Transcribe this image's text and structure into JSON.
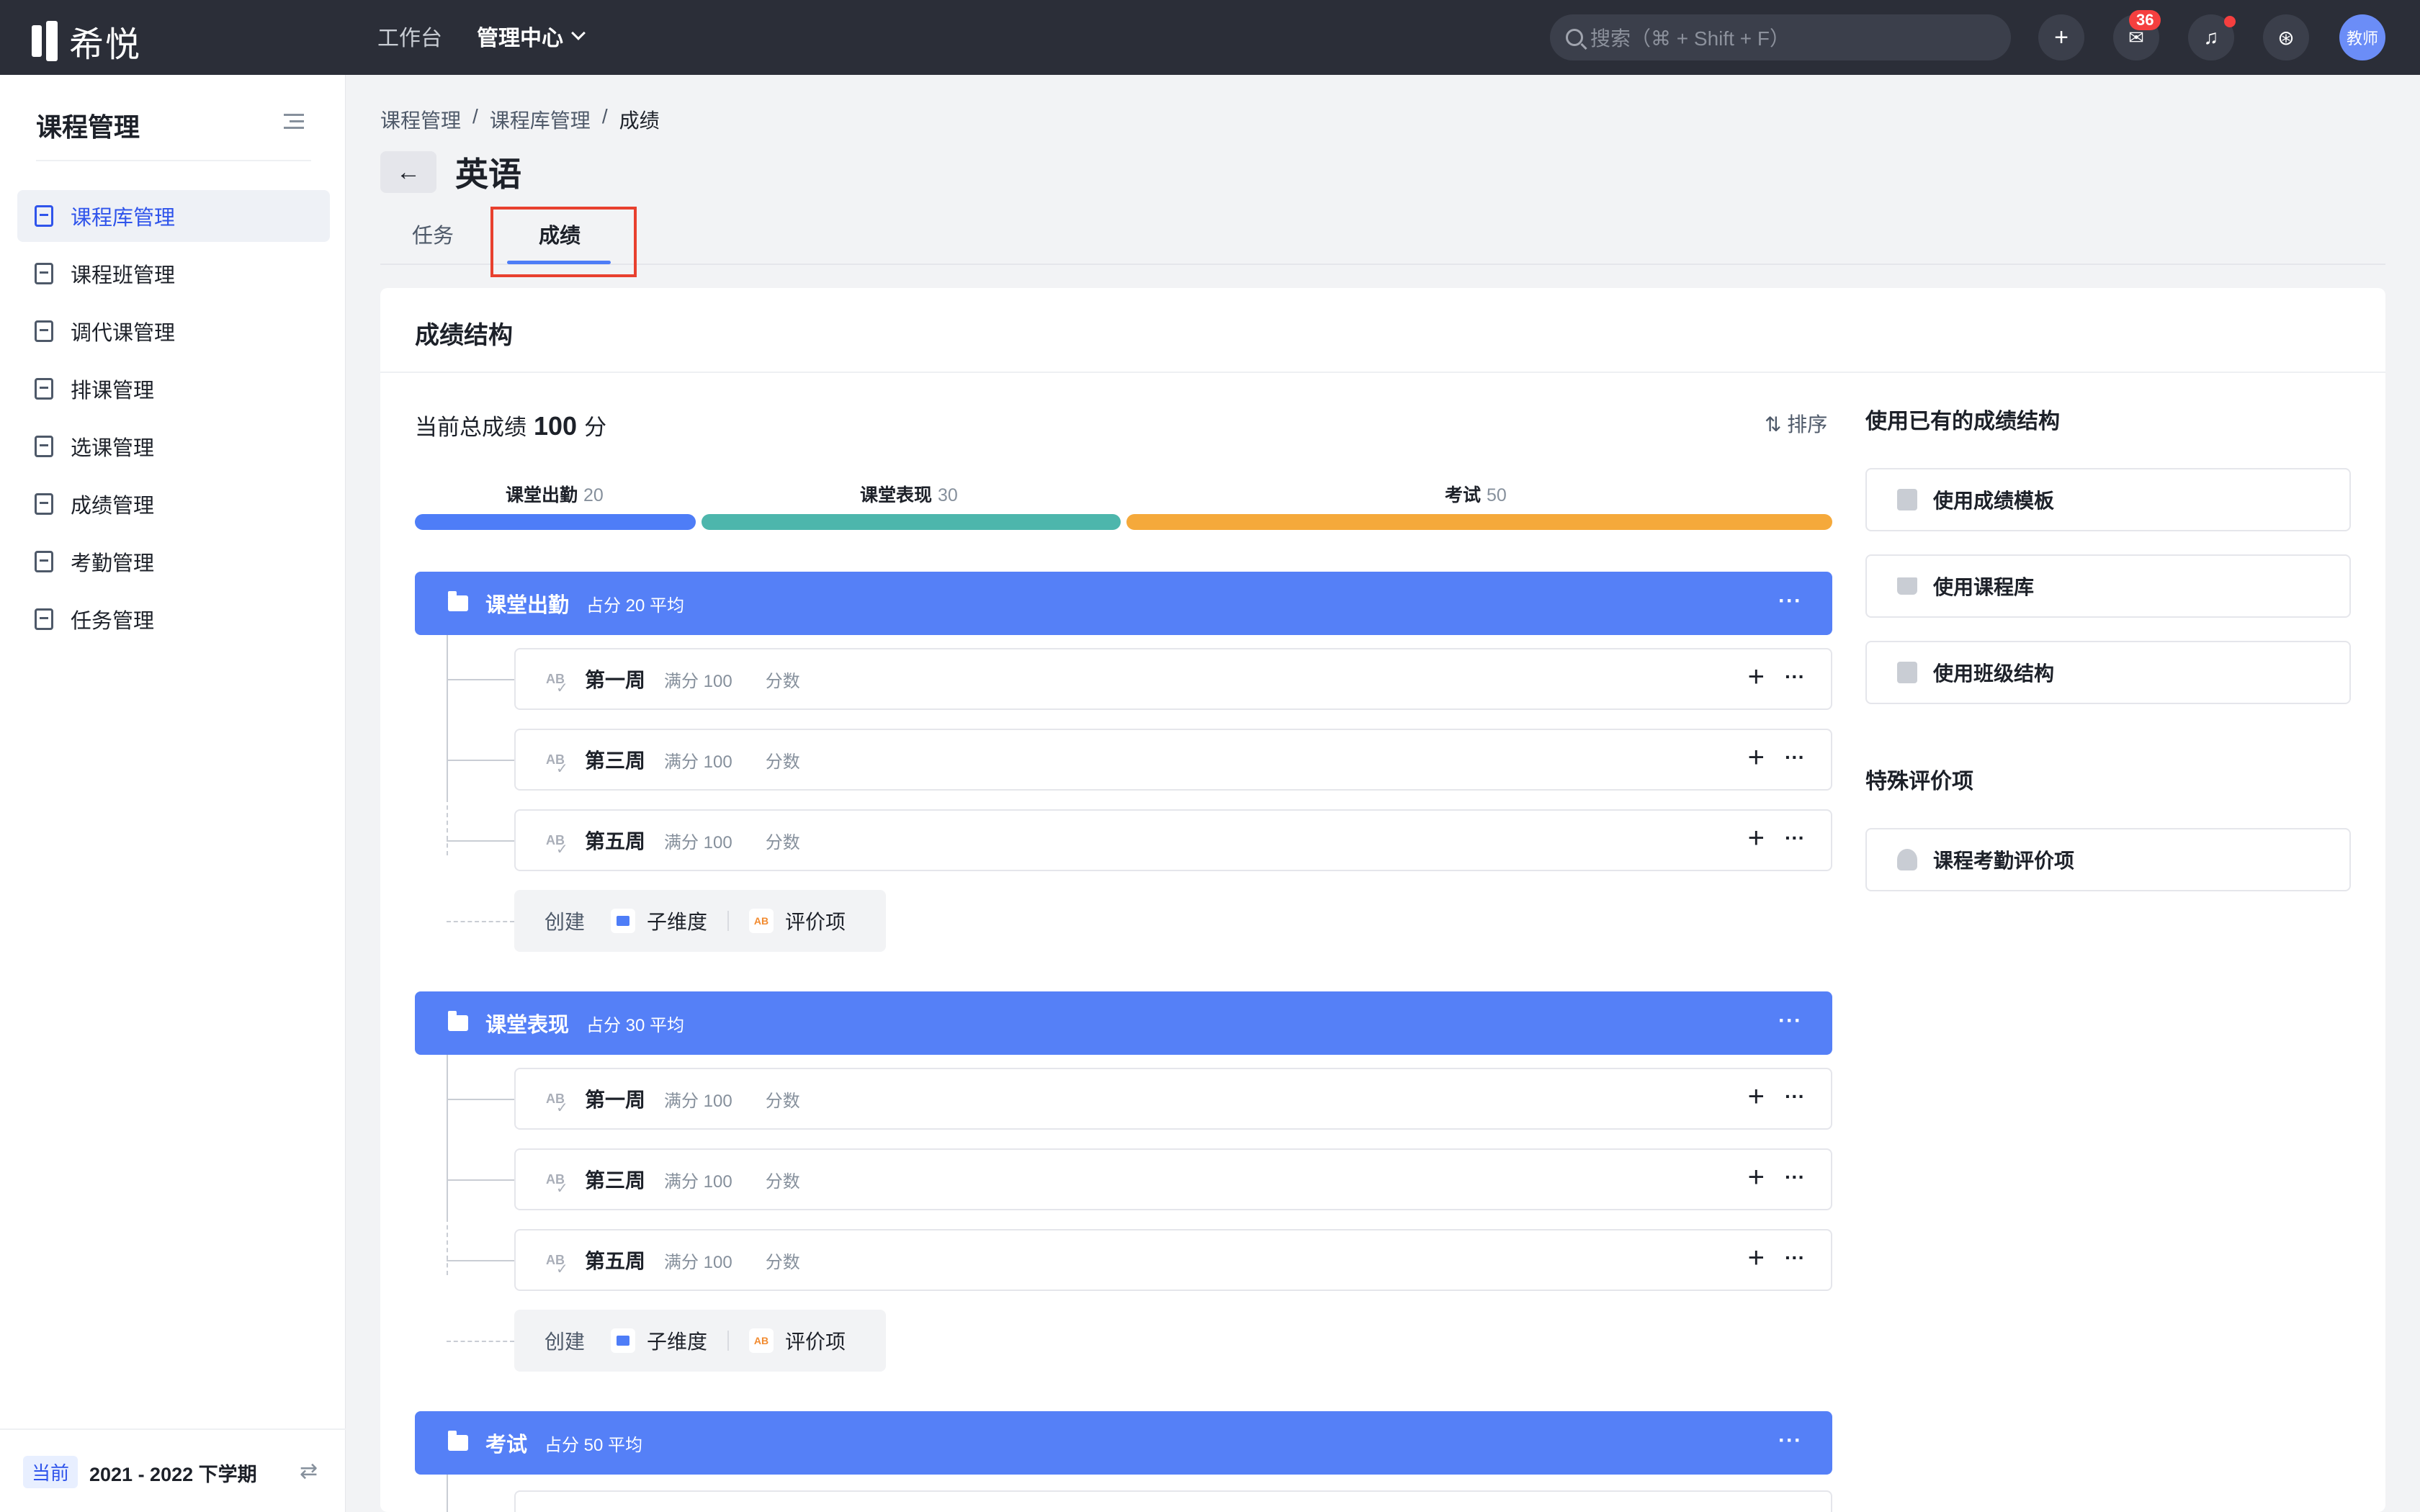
{
  "app": {
    "logo_text": "希悦",
    "nav": [
      "工作台",
      "管理中心"
    ],
    "search_placeholder": "搜索（⌘ + Shift + F）",
    "message_count": "36",
    "avatar_label": "教师"
  },
  "sidebar": {
    "title": "课程管理",
    "items": [
      {
        "label": "课程库管理",
        "icon": "course-library-icon",
        "active": true
      },
      {
        "label": "课程班管理",
        "icon": "course-class-icon"
      },
      {
        "label": "调代课管理",
        "icon": "substitute-icon"
      },
      {
        "label": "排课管理",
        "icon": "schedule-icon"
      },
      {
        "label": "选课管理",
        "icon": "course-selection-icon"
      },
      {
        "label": "成绩管理",
        "icon": "grade-icon"
      },
      {
        "label": "考勤管理",
        "icon": "attendance-icon"
      },
      {
        "label": "任务管理",
        "icon": "task-list-icon"
      }
    ],
    "term_tag": "当前",
    "term": "2021 - 2022 下学期"
  },
  "breadcrumb": [
    "课程管理",
    "课程库管理",
    "成绩"
  ],
  "page_title": "英语",
  "tabs": [
    {
      "label": "任务"
    },
    {
      "label": "成绩",
      "active": true
    }
  ],
  "panel": {
    "title": "成绩结构",
    "total_label": "当前总成绩",
    "total_value": "100",
    "total_unit": "分",
    "sort_label": "排序",
    "bars": [
      {
        "name": "课堂出勤",
        "value": "20",
        "color": "#4e7df7"
      },
      {
        "name": "课堂表现",
        "value": "30",
        "color": "#4db6ac"
      },
      {
        "name": "考试",
        "value": "50",
        "color": "#f5a93b"
      }
    ],
    "groups": [
      {
        "name": "课堂出勤",
        "meta": "占分 20 平均",
        "rows": [
          {
            "name": "第一周",
            "meta": "满分 100",
            "unit": "分数"
          },
          {
            "name": "第三周",
            "meta": "满分 100",
            "unit": "分数"
          },
          {
            "name": "第五周",
            "meta": "满分 100",
            "unit": "分数"
          }
        ]
      },
      {
        "name": "课堂表现",
        "meta": "占分 30 平均",
        "rows": [
          {
            "name": "第一周",
            "meta": "满分 100",
            "unit": "分数"
          },
          {
            "name": "第三周",
            "meta": "满分 100",
            "unit": "分数"
          },
          {
            "name": "第五周",
            "meta": "满分 100",
            "unit": "分数"
          }
        ]
      },
      {
        "name": "考试",
        "meta": "占分 50 平均",
        "rows": []
      }
    ],
    "create": {
      "label": "创建",
      "sub_dimension": "子维度",
      "eval_item": "评价项"
    },
    "side": {
      "use_existing_title": "使用已有的成绩结构",
      "buttons": [
        "使用成绩模板",
        "使用课程库",
        "使用班级结构"
      ],
      "special_title": "特殊评价项",
      "special_buttons": [
        "课程考勤评价项"
      ]
    }
  }
}
